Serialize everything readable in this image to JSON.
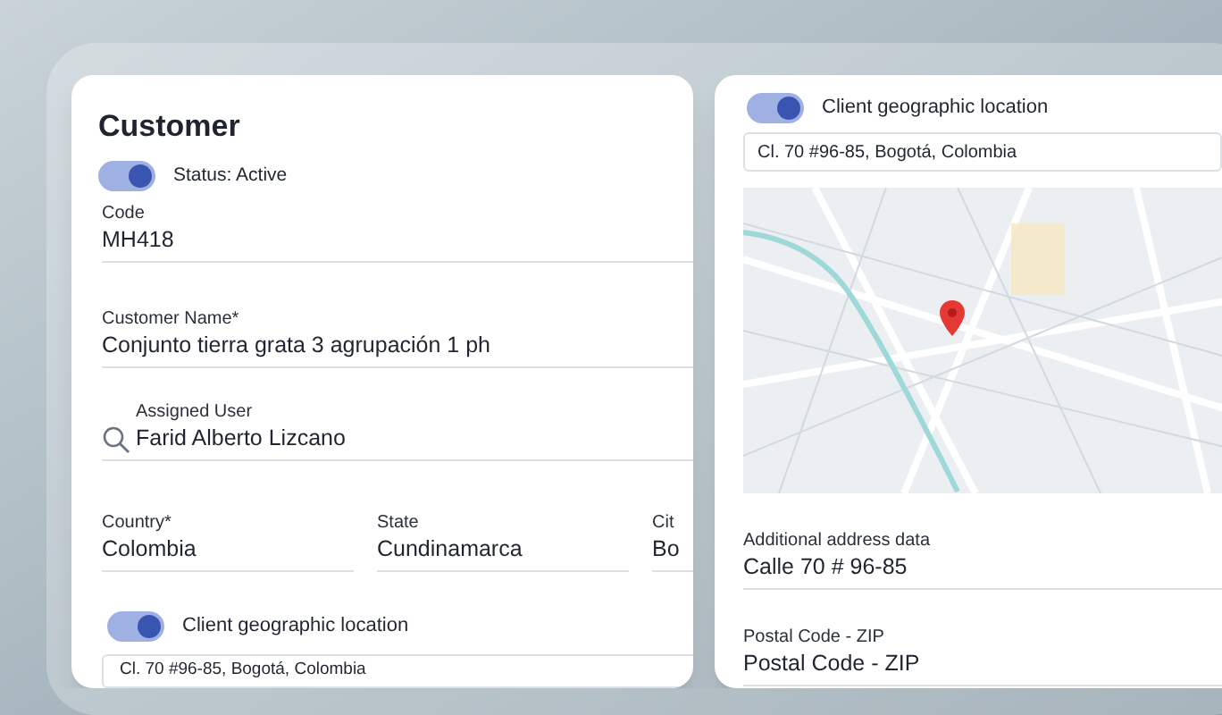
{
  "customer": {
    "title": "Customer",
    "status": {
      "on": true,
      "label": "Status: Active"
    },
    "fields": [
      {
        "kind": "plain",
        "label": "Code",
        "value": "MH418"
      },
      {
        "kind": "plain",
        "label": "Customer Name*",
        "value": "Conjunto tierra grata 3 agrupación 1 ph"
      },
      {
        "kind": "search",
        "label": "Assigned User",
        "value": "Farid Alberto Lizcano"
      }
    ],
    "location_fields": [
      {
        "label": "Country*",
        "value": "Colombia"
      },
      {
        "label": "State",
        "value": "Cundinamarca"
      },
      {
        "label": "Cit",
        "value": "Bo"
      }
    ],
    "geolocation": {
      "on": true,
      "label": "Client geographic location",
      "address": "Cl. 70 #96-85, Bogotá, Colombia"
    }
  },
  "location_panel": {
    "geolocation": {
      "on": true,
      "label": "Client geographic location",
      "address": "Cl. 70 #96-85, Bogotá, Colombia"
    },
    "fields": [
      {
        "label": "Additional address data",
        "value": "Calle 70 # 96-85"
      },
      {
        "label": "Postal Code - ZIP",
        "value": "Postal Code - ZIP"
      }
    ]
  }
}
